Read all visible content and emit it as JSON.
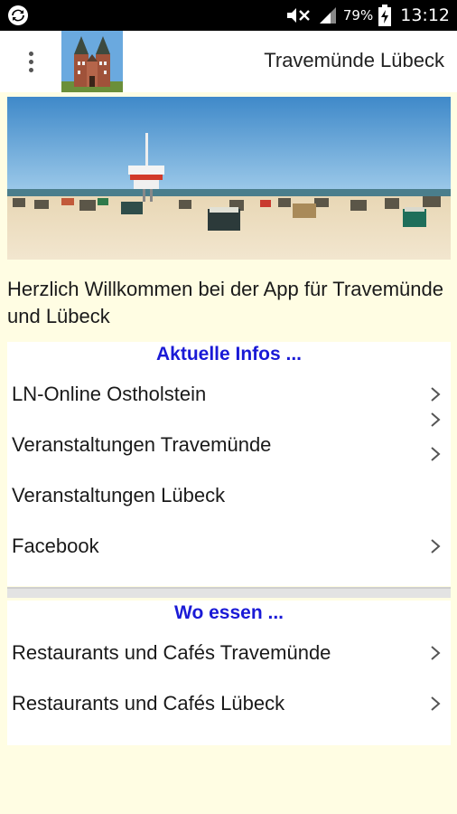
{
  "status_bar": {
    "battery": "79%",
    "time": "13:12",
    "icons": [
      "sync-icon",
      "mute-icon",
      "signal-icon",
      "battery-charging-icon"
    ]
  },
  "toolbar": {
    "title": "Travemünde Lübeck",
    "menu_icon": "overflow-menu-icon",
    "logo": "holstentor-logo"
  },
  "hero": {
    "image": "beach-with-lifeguard-tower"
  },
  "welcome_text": "Herzlich Willkommen bei der App für Travemünde und Lübeck",
  "sections": [
    {
      "title": "Aktuelle Infos ...",
      "items": [
        {
          "label": "LN-Online Ostholstein"
        },
        {
          "label": "Veranstaltungen Travemünde"
        },
        {
          "label": "Veranstaltungen Lübeck"
        },
        {
          "label": "Facebook"
        }
      ]
    },
    {
      "title": "Wo essen ...",
      "items": [
        {
          "label": "Restaurants und Cafés Travemünde"
        },
        {
          "label": "Restaurants und Cafés Lübeck"
        }
      ]
    }
  ],
  "colors": {
    "background": "#fffde3",
    "section_title": "#1a1ad6",
    "status_bar": "#000000"
  }
}
